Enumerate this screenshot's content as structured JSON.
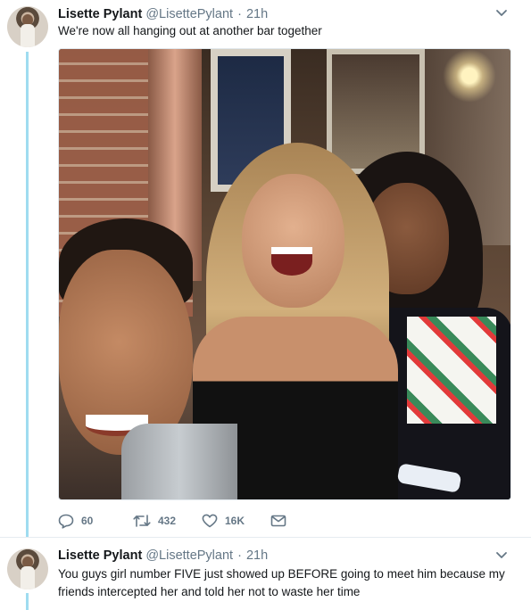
{
  "tweets": [
    {
      "display_name": "Lisette Pylant",
      "handle": "@LisettePylant",
      "separator": "·",
      "time": "21h",
      "text": "We're now all hanging out at another bar together",
      "actions": {
        "reply_count": "60",
        "retweet_count": "432",
        "like_count": "16K"
      }
    },
    {
      "display_name": "Lisette Pylant",
      "handle": "@LisettePylant",
      "separator": "·",
      "time": "21h",
      "text": "You guys girl number FIVE just showed up BEFORE going to meet him because my friends intercepted her and told her not to waste her time"
    }
  ],
  "colors": {
    "thread_line": "#9fdcf0",
    "secondary_text": "#657786",
    "primary_text": "#14171a"
  },
  "icons": [
    "reply-icon",
    "retweet-icon",
    "like-icon",
    "direct-message-icon",
    "caret-down-icon"
  ]
}
